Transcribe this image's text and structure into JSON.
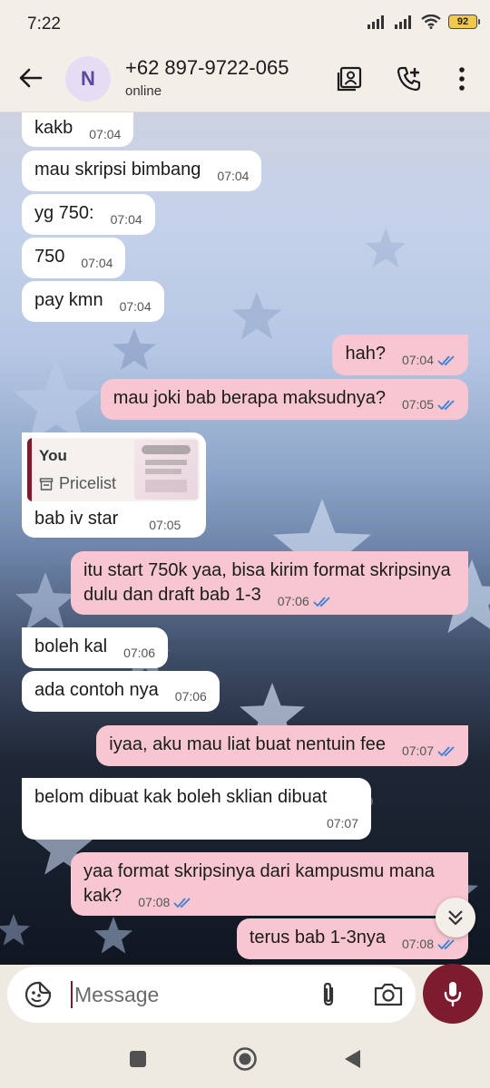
{
  "status_bar": {
    "time": "7:22",
    "battery": "92"
  },
  "header": {
    "avatar_letter": "N",
    "contact_name": "+62 897-9722-065",
    "contact_status": "online"
  },
  "messages": [
    {
      "dir": "in",
      "text": "kakb",
      "time": "07:04"
    },
    {
      "dir": "in",
      "text": "mau skripsi bimbang",
      "time": "07:04"
    },
    {
      "dir": "in",
      "text": "yg 750:",
      "time": "07:04"
    },
    {
      "dir": "in",
      "text": "750",
      "time": "07:04"
    },
    {
      "dir": "in",
      "text": "pay kmn",
      "time": "07:04"
    },
    {
      "dir": "out",
      "text": "hah?",
      "time": "07:04"
    },
    {
      "dir": "out",
      "text": "mau joki bab berapa maksudnya?",
      "time": "07:05"
    },
    {
      "dir": "in",
      "text": "bab iv star",
      "time": "07:05",
      "reply": {
        "author": "You",
        "label": "Pricelist"
      }
    },
    {
      "dir": "out",
      "text": "itu start 750k yaa, bisa kirim format skripsinya dulu dan draft bab 1-3",
      "time": "07:06"
    },
    {
      "dir": "in",
      "text": "boleh kal",
      "time": "07:06"
    },
    {
      "dir": "in",
      "text": "ada contoh nya",
      "time": "07:06"
    },
    {
      "dir": "out",
      "text": "iyaa, aku mau liat buat nentuin fee",
      "time": "07:07"
    },
    {
      "dir": "in",
      "text": "belom dibuat kak boleh sklian dibuat",
      "time": "07:07"
    },
    {
      "dir": "out",
      "text": "yaa format skripsinya dari kampusmu mana kak?",
      "time": "07:08"
    },
    {
      "dir": "out",
      "text": "terus bab 1-3nya",
      "time": "07:08"
    }
  ],
  "composer": {
    "placeholder": "Message"
  },
  "colors": {
    "accent": "#7c1c2e",
    "outgoing_bubble": "#f7c6d0",
    "incoming_bubble": "#ffffff",
    "read_tick": "#3b7fd6"
  },
  "icons": {
    "back": "arrow-left-icon",
    "contact_card": "contact-card-icon",
    "add_call": "phone-plus-icon",
    "more": "more-vertical-icon",
    "emoji": "sticker-smile-icon",
    "attach": "paperclip-icon",
    "camera": "camera-icon",
    "mic": "microphone-icon",
    "scroll_down": "double-chevron-down-icon",
    "read": "double-check-icon",
    "reply_doc": "store-icon"
  }
}
